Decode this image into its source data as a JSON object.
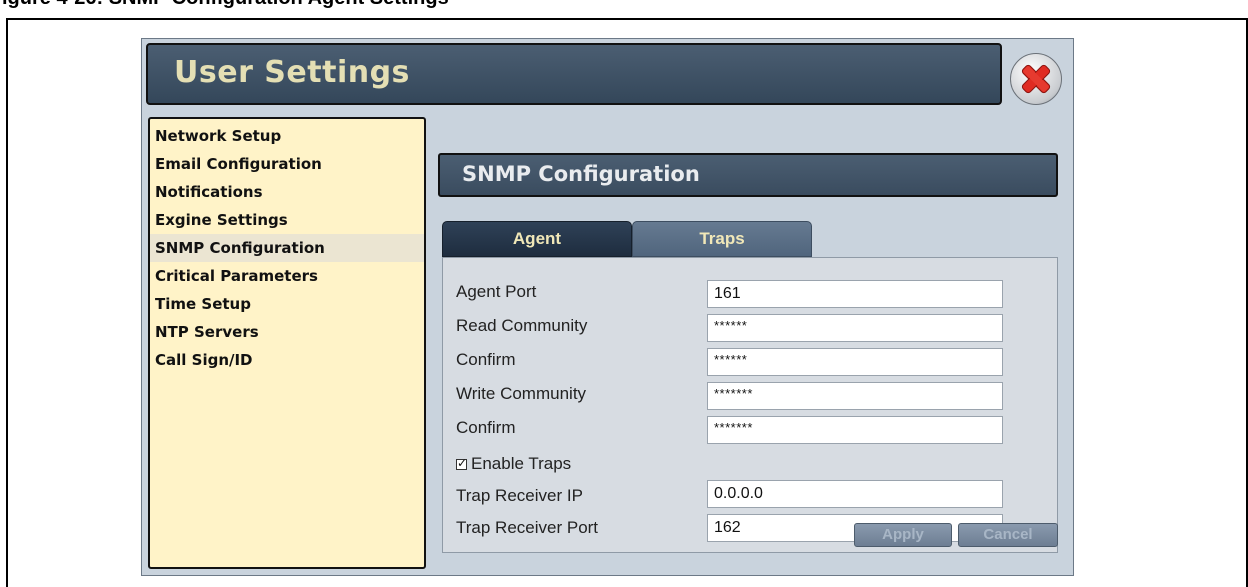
{
  "document": {
    "heading": "igure 4-26: SNMP Configuration Agent Settings"
  },
  "window": {
    "title": "User Settings"
  },
  "sidebar": {
    "items": [
      {
        "label": "Network Setup",
        "active": false
      },
      {
        "label": "Email Configuration",
        "active": false
      },
      {
        "label": "Notifications",
        "active": false
      },
      {
        "label": "Exgine Settings",
        "active": false
      },
      {
        "label": "SNMP Configuration",
        "active": true
      },
      {
        "label": "Critical Parameters",
        "active": false
      },
      {
        "label": "Time Setup",
        "active": false
      },
      {
        "label": "NTP Servers",
        "active": false
      },
      {
        "label": "Call Sign/ID",
        "active": false
      }
    ]
  },
  "panel": {
    "title": "SNMP Configuration",
    "tabs": [
      {
        "label": "Agent",
        "selected": true
      },
      {
        "label": "Traps",
        "selected": false
      }
    ],
    "fields": {
      "agent_port": {
        "label": "Agent Port",
        "value": "161"
      },
      "read_community": {
        "label": "Read Community",
        "value": "******"
      },
      "read_confirm": {
        "label": "Confirm",
        "value": "******"
      },
      "write_community": {
        "label": "Write Community",
        "value": "*******"
      },
      "write_confirm": {
        "label": "Confirm",
        "value": "*******"
      },
      "enable_traps": {
        "label": "Enable Traps",
        "checked": true,
        "check_glyph": "✓"
      },
      "trap_receiver_ip": {
        "label": "Trap Receiver IP",
        "value": "0.0.0.0"
      },
      "trap_receiver_port": {
        "label": "Trap Receiver Port",
        "value": "162"
      }
    },
    "buttons": {
      "apply": "Apply",
      "cancel": "Cancel"
    }
  },
  "icons": {
    "close": "close-icon"
  },
  "colors": {
    "title_text": "#e4dfb4",
    "sidebar_bg": "#fff3c8",
    "close_red": "#e02b22"
  }
}
